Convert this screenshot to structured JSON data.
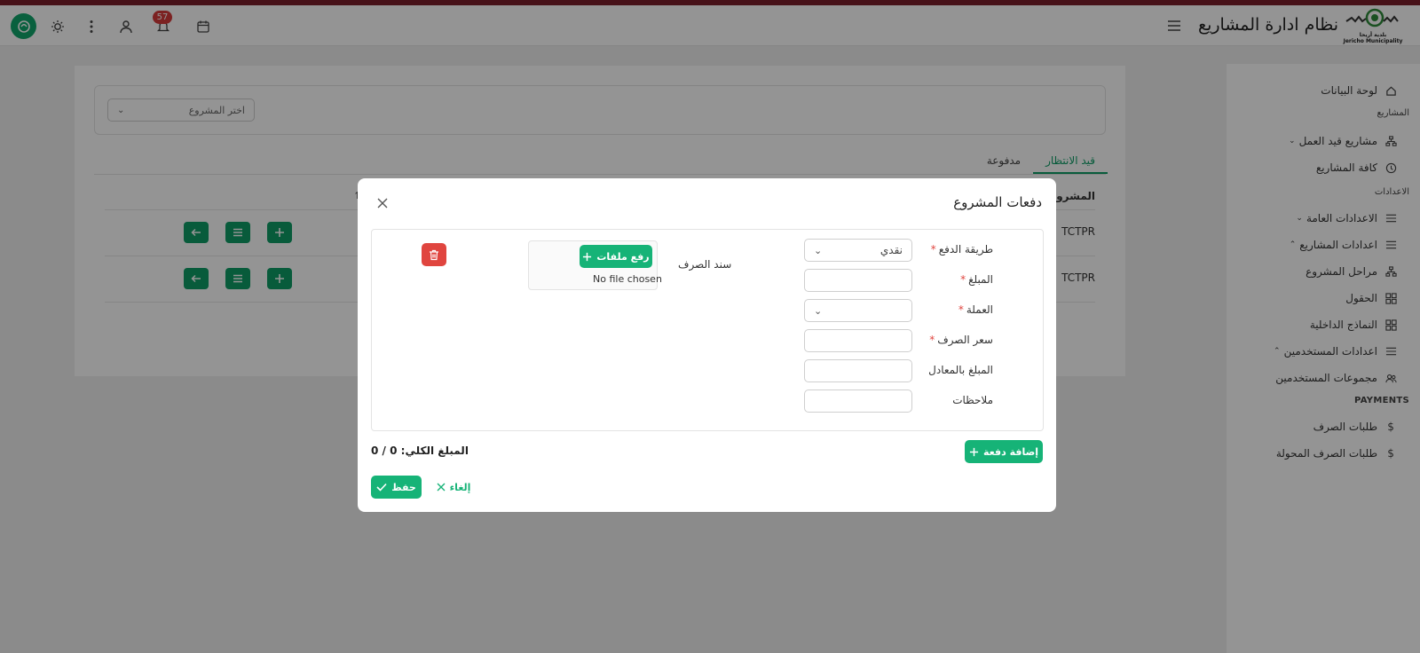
{
  "header": {
    "app_title": "نظام ادارة المشاريع",
    "logo_text": "بلدية أريحا",
    "logo_text_en": "Jericho Municipality",
    "notification_count": "57",
    "icons": [
      "menu-icon",
      "calendar-icon",
      "bell-icon",
      "user-icon",
      "more-vertical-icon",
      "sun-icon",
      "brand-icon"
    ]
  },
  "sidebar": {
    "dashboard": "لوحة البيانات",
    "section_projects": "المشاريع",
    "in_progress_projects": "مشاريع قيد العمل",
    "all_projects": "كافة المشاريع",
    "section_settings": "الاعدادات",
    "general_settings": "الاعدادات العامة",
    "project_settings": "اعدادات المشاريع",
    "project_stages": "مراحل المشروع",
    "fields": "الحقول",
    "internal_forms": "النماذج الداخلية",
    "user_settings": "اعدادات المستخدمين",
    "user_groups": "مجموعات المستخدمين",
    "section_payments": "PAYMENTS",
    "disbursement_requests": "طلبات الصرف",
    "transferred_requests": "طلبات الصرف المحولة"
  },
  "main": {
    "project_select_placeholder": "اختر المشروع",
    "tab_pending": "قيد الانتظار",
    "tab_paid": "مدفوعة",
    "column_project": "المشرو",
    "sort_icon": "↑",
    "rows": [
      {
        "code": "TCTPR"
      },
      {
        "code": "TCTPR"
      }
    ]
  },
  "modal": {
    "title": "دفعات المشروع",
    "payment_method_label": "طريقة الدفع",
    "payment_method_value": "نقدي",
    "amount_label": "المبلغ",
    "currency_label": "العملة",
    "exchange_rate_label": "سعر الصرف",
    "equivalent_amount_label": "المبلغ بالمعادل",
    "notes_label": "ملاحظات",
    "required_mark": "*",
    "receipt_label": "سند الصرف",
    "upload_label": "رفع ملفات",
    "no_file": "No file chosen",
    "add_payment": "إضافة دفعة",
    "total_label": "المبلغ الكلي:",
    "total_value": "0 / 0",
    "cancel": "إلغاء",
    "save": "حفظ"
  },
  "colors": {
    "accent": "#16b377",
    "accent_dark": "#0e9e67",
    "danger": "#e0453f",
    "top_bar": "#7a1f2b",
    "badge": "#d63b3b"
  }
}
